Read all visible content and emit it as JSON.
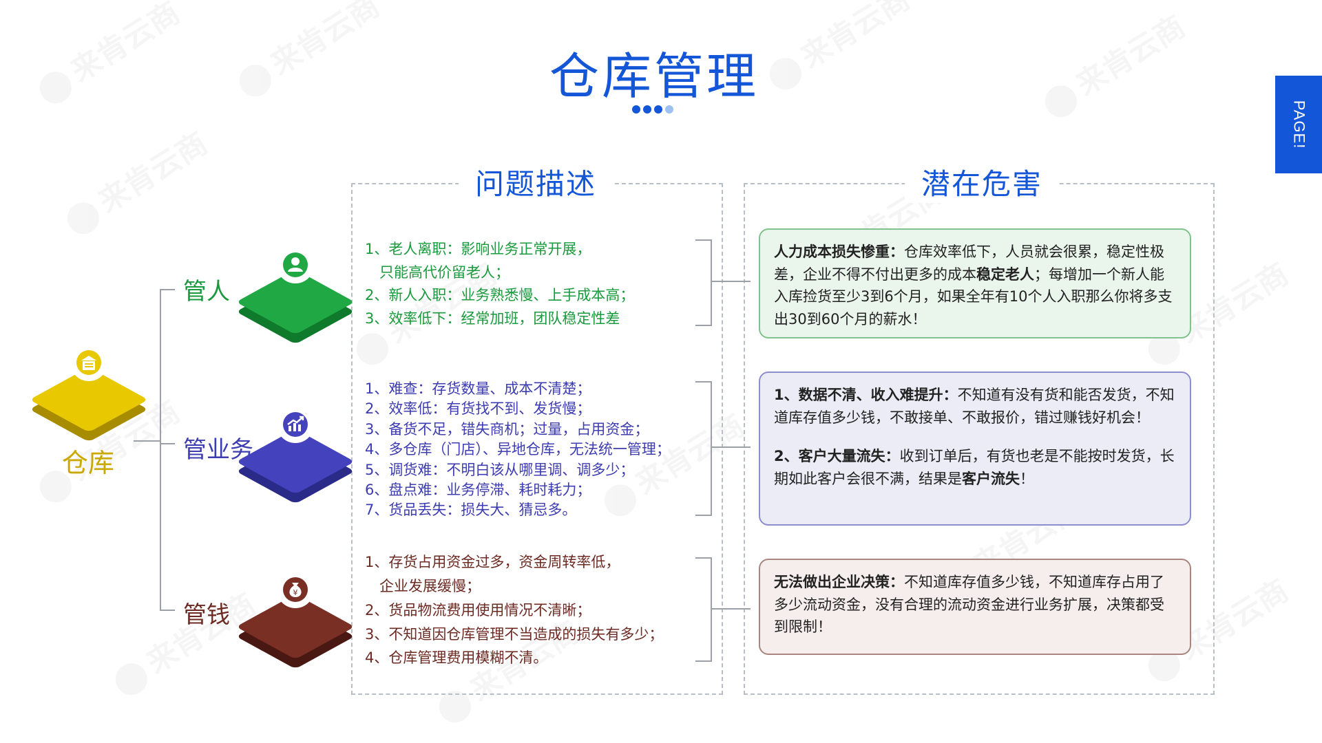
{
  "header": {
    "title": "仓库管理",
    "page_tab": "PAGE!"
  },
  "root": {
    "label": "仓库"
  },
  "panels": {
    "left_title": "问题描述",
    "right_title": "潜在危害"
  },
  "categories": [
    {
      "label": "管人",
      "color": "#1a9a3c",
      "icon": "person-icon",
      "items": [
        "1、老人离职：影响业务正常开展，",
        "　只能高代价留老人；",
        "2、新人入职：业务熟悉慢、上手成本高；",
        "3、效率低下：经常加班，团队稳定性差"
      ]
    },
    {
      "label": "管业务",
      "color": "#3d3cb0",
      "icon": "growth-chart-icon",
      "items": [
        "1、难查：存货数量、成本不清楚；",
        "2、效率低：有货找不到、发货慢；",
        "3、备货不足，错失商机；过量，占用资金；",
        "4、多仓库（门店）、异地仓库，无法统一管理；",
        "5、调货难：不明白该从哪里调、调多少；",
        "6、盘点难：业务停滞、耗时耗力；",
        "7、货品丢失：损失大、猜忌多。"
      ]
    },
    {
      "label": "管钱",
      "color": "#6d2a22",
      "icon": "money-bag-icon",
      "items": [
        "1、存货占用资金过多，资金周转率低，",
        "　企业发展缓慢；",
        "2、货品物流费用使用情况不清晰；",
        "3、不知道因仓库管理不当造成的损失有多少；",
        "4、仓库管理费用模糊不清。"
      ]
    }
  ],
  "risks": {
    "box1": {
      "bold1": "人力成本损失惨重：",
      "text1": "仓库效率低下，人员就会很累，稳定性极差，企业不得不付出更多的成本",
      "bold2": "稳定老人",
      "text2": "；每增加一个新人能入库捡货至少3到6个月，如果全年有10个人入职那么你将多支出30到60个月的薪水！"
    },
    "box2": {
      "bold1": "1、数据不清、收入难提升：",
      "text1": "不知道有没有货和能否发货，不知道库存值多少钱，不敢接单、不敢报价，错过赚钱好机会！",
      "bold2": "2、客户大量流失：",
      "text2": "收到订单后，有货也老是不能按时发货，长期如此客户会很不满，结果是",
      "bold3": "客户流失",
      "text3": "！"
    },
    "box3": {
      "bold1": "无法做出企业决策：",
      "text1": "不知道库存值多少钱，不知道库存占用了多少流动资金，没有合理的流动资金进行业务扩展，决策都受到限制！"
    }
  },
  "colors": {
    "accent": "#1456d8",
    "green": "#1a9a3c",
    "navy": "#3d3cb0",
    "brown": "#6d2a22",
    "gold": "#c9a800"
  }
}
